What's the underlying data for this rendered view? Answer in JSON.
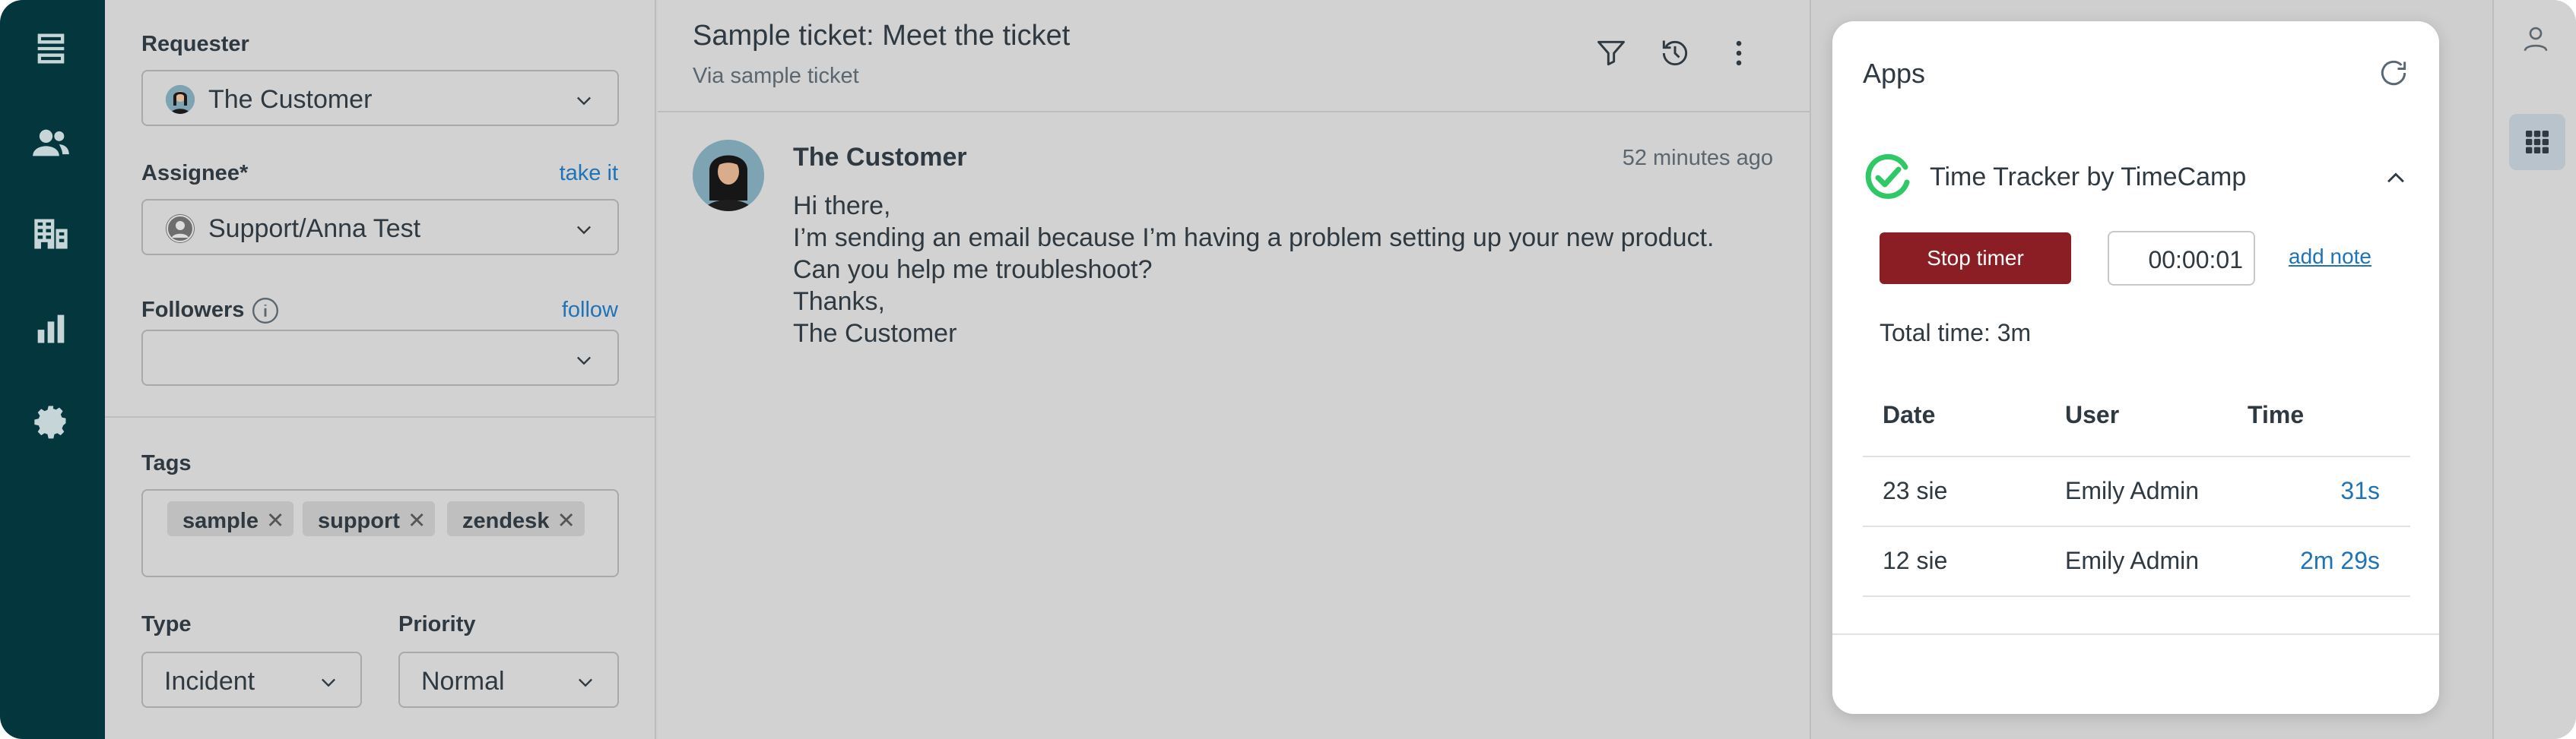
{
  "nav": {
    "items": [
      "views-icon",
      "customers-icon",
      "organizations-icon",
      "reporting-icon",
      "admin-icon"
    ]
  },
  "properties": {
    "requester": {
      "label": "Requester",
      "value": "The Customer"
    },
    "assignee": {
      "label": "Assignee*",
      "action": "take it",
      "value": "Support/Anna Test"
    },
    "followers": {
      "label": "Followers",
      "action": "follow",
      "value": ""
    },
    "tags": {
      "label": "Tags",
      "items": [
        "sample",
        "support",
        "zendesk"
      ]
    },
    "type": {
      "label": "Type",
      "value": "Incident"
    },
    "priority": {
      "label": "Priority",
      "value": "Normal"
    }
  },
  "ticket": {
    "title": "Sample ticket: Meet the ticket",
    "via": "Via sample ticket",
    "message": {
      "author": "The Customer",
      "time": "52 minutes ago",
      "lines": [
        "Hi there,",
        "I’m sending an email because I’m having a problem setting up your new product.",
        "Can you help me troubleshoot?",
        "Thanks,",
        "The Customer"
      ]
    }
  },
  "apps": {
    "title": "Apps",
    "app_name": "Time Tracker by TimeCamp",
    "stop_label": "Stop timer",
    "timer": "00:00:01",
    "add_note": "add note",
    "total": "Total time: 3m",
    "table": {
      "headers": [
        "Date",
        "User",
        "Time"
      ],
      "rows": [
        {
          "date": "23 sie",
          "user": "Emily Admin",
          "time": "31s"
        },
        {
          "date": "12 sie",
          "user": "Emily Admin",
          "time": "2m 29s"
        }
      ]
    }
  },
  "colors": {
    "nav_bg": "#03363d",
    "link": "#1f73b7",
    "stop_button": "#8b1e25",
    "timecamp_green": "#2ec866"
  }
}
